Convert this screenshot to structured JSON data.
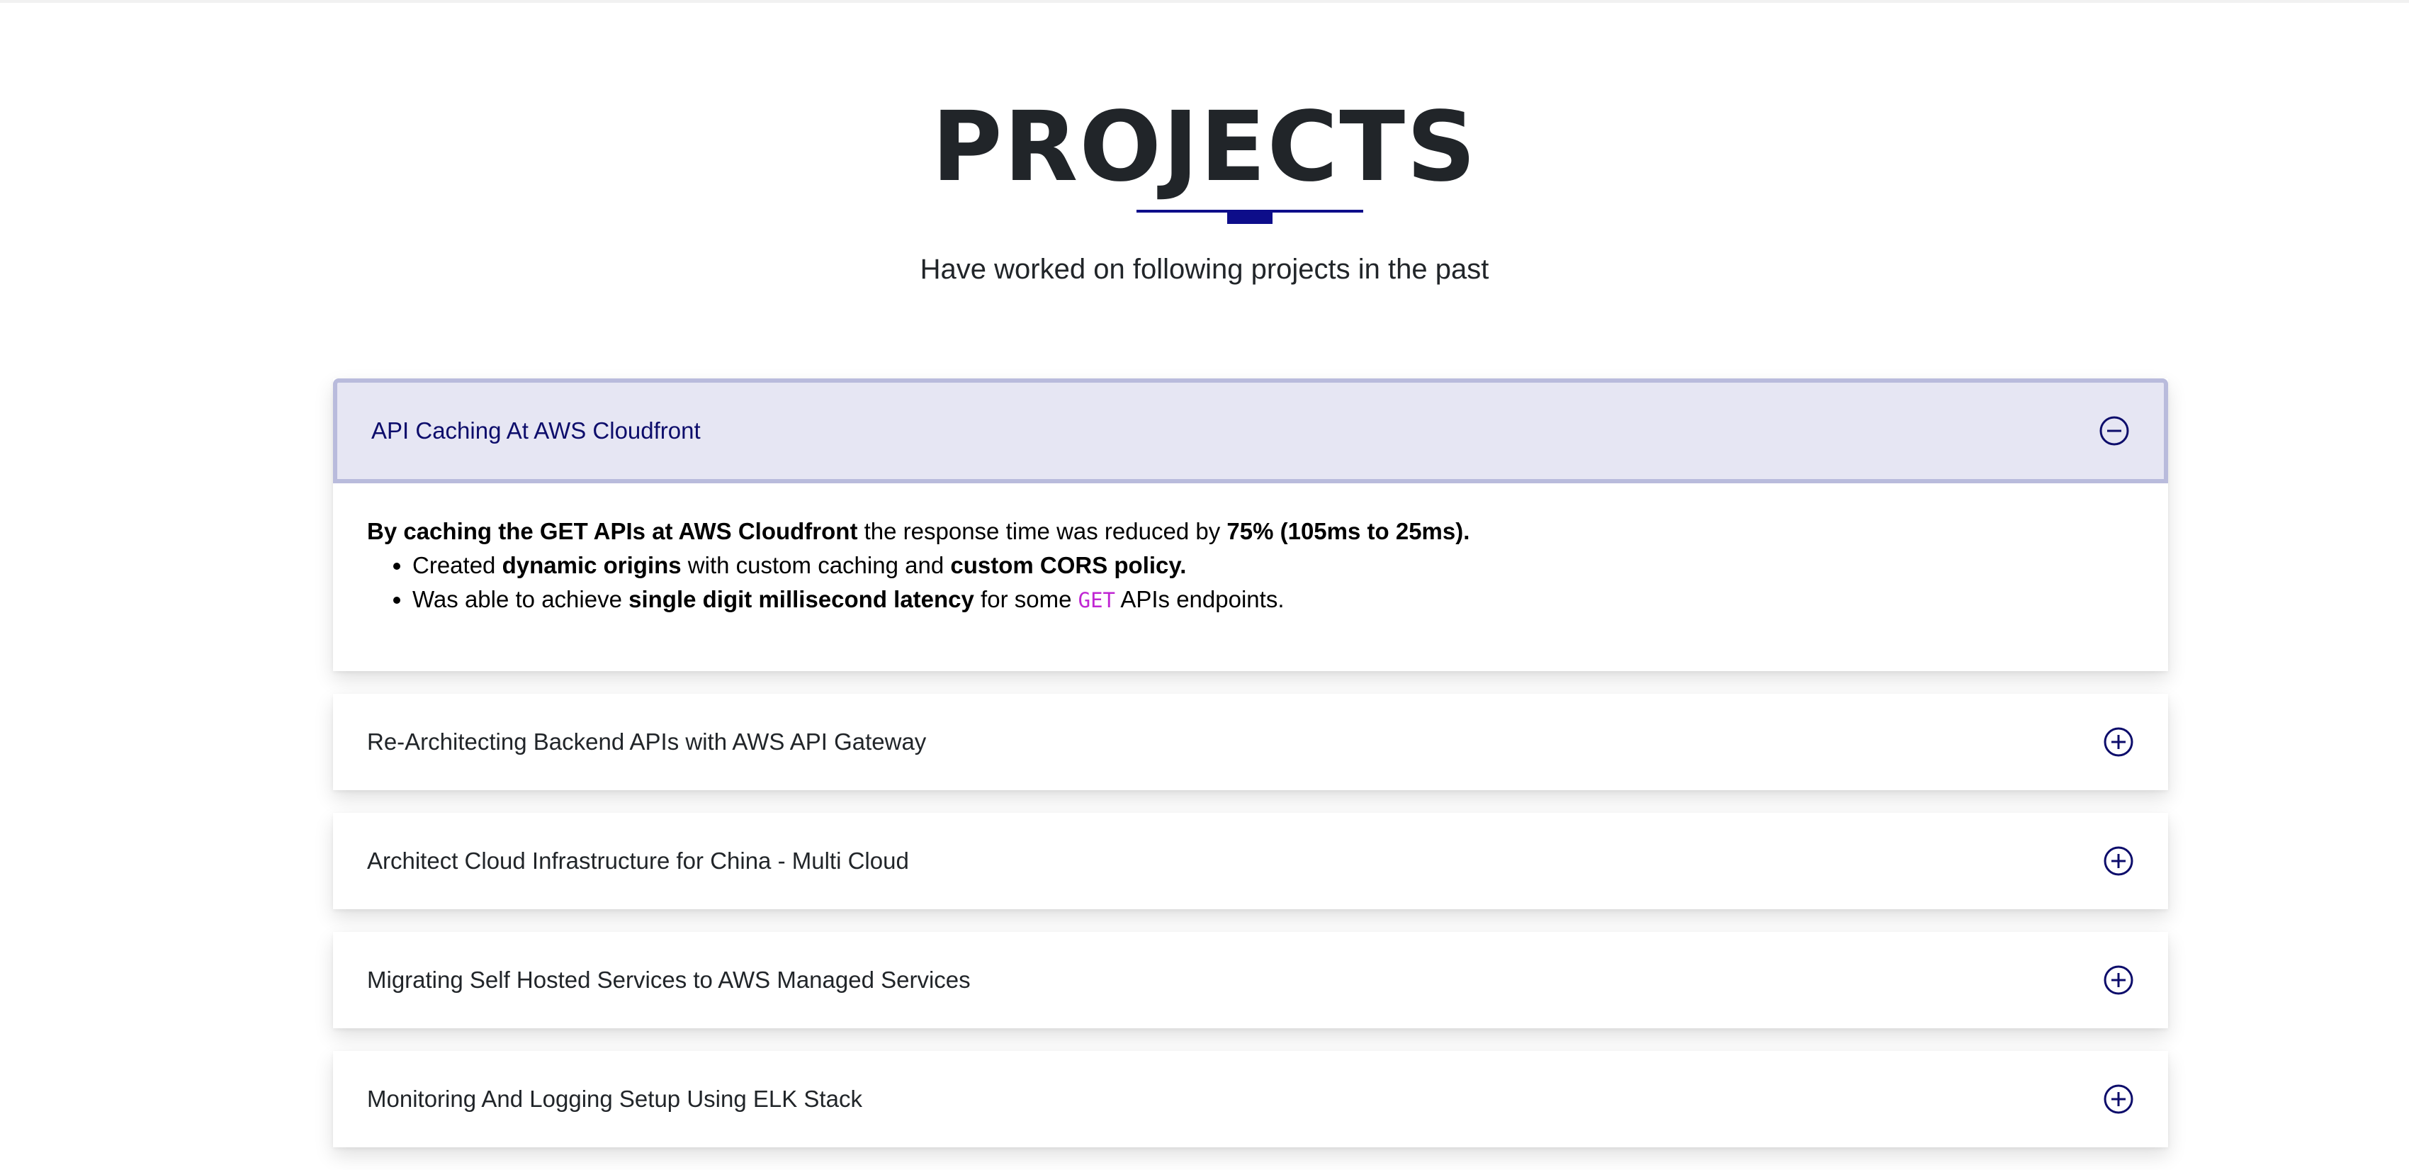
{
  "section": {
    "title": "PROJECTS",
    "subtitle": "Have worked on following projects in the past"
  },
  "colors": {
    "accent": "#0d0d8a",
    "open_header_bg": "#e6e6f3",
    "open_header_border": "#b9bbdc",
    "code_color": "#c026d3"
  },
  "projects": [
    {
      "title": "API Caching At AWS Cloudfront",
      "expanded": true,
      "toggle_icon": "minus-circle-icon",
      "summary": {
        "bold_lead": "By caching the GET APIs at AWS Cloudfront",
        "middle": " the response time was reduced by ",
        "bold_tail": "75% (105ms to 25ms)."
      },
      "bullets": [
        {
          "t1": "Created ",
          "b1": "dynamic origins",
          "t2": " with custom caching and ",
          "b2": "custom CORS policy."
        },
        {
          "t1": "Was able to achieve ",
          "b1": "single digit millisecond latency",
          "t2": " for some ",
          "code": "GET",
          "t3": " APIs endpoints."
        }
      ]
    },
    {
      "title": "Re-Architecting Backend APIs with AWS API Gateway",
      "expanded": false,
      "toggle_icon": "plus-circle-icon"
    },
    {
      "title": "Architect Cloud Infrastructure for China - Multi Cloud",
      "expanded": false,
      "toggle_icon": "plus-circle-icon"
    },
    {
      "title": "Migrating Self Hosted Services to AWS Managed Services",
      "expanded": false,
      "toggle_icon": "plus-circle-icon"
    },
    {
      "title": "Monitoring And Logging Setup Using ELK Stack",
      "expanded": false,
      "toggle_icon": "plus-circle-icon"
    }
  ]
}
